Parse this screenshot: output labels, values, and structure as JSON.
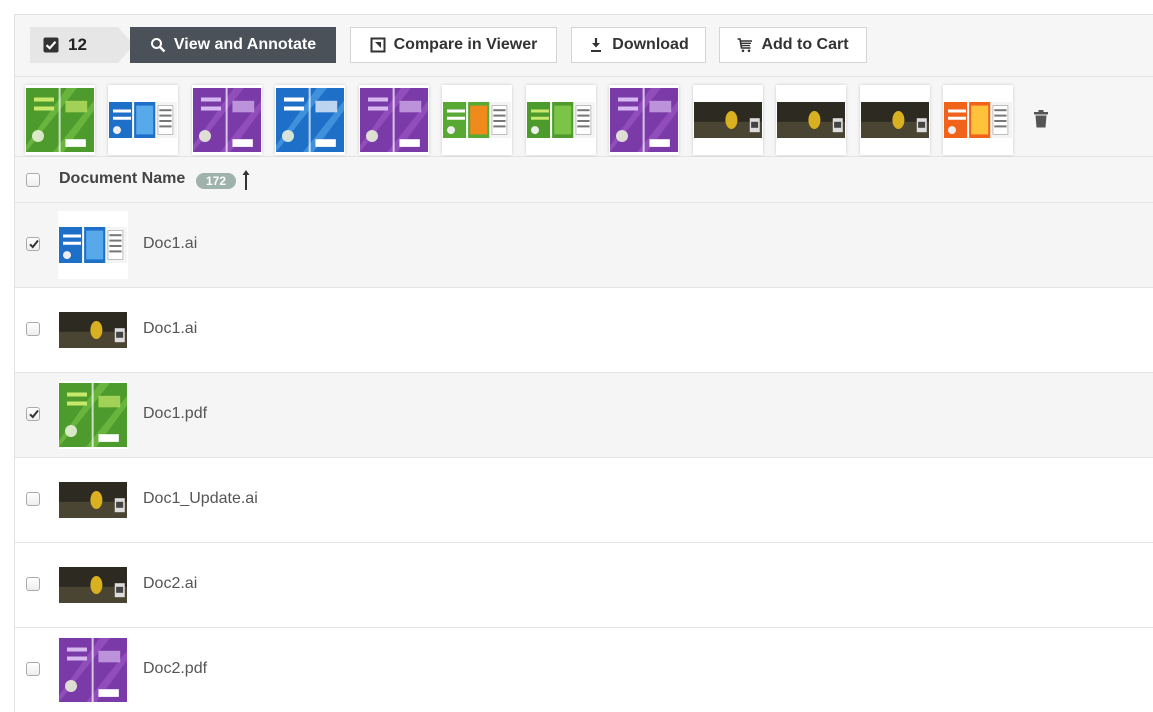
{
  "toolbar": {
    "selected_count": "12",
    "view_annotate_label": "View and Annotate",
    "compare_label": "Compare in Viewer",
    "download_label": "Download",
    "add_to_cart_label": "Add to Cart"
  },
  "thumbnails": [
    {
      "kind": "green-tall"
    },
    {
      "kind": "blue-wide"
    },
    {
      "kind": "purple-tall"
    },
    {
      "kind": "blue-tall"
    },
    {
      "kind": "purple-tall"
    },
    {
      "kind": "greenorange-wide"
    },
    {
      "kind": "green-wide"
    },
    {
      "kind": "purple-tall"
    },
    {
      "kind": "dark-wide"
    },
    {
      "kind": "dark-wide"
    },
    {
      "kind": "dark-wide"
    },
    {
      "kind": "orange-wide"
    }
  ],
  "header": {
    "column_title": "Document Name",
    "count": "172"
  },
  "rows": [
    {
      "name": "Doc1.ai",
      "checked": true,
      "kind": "blue-wide"
    },
    {
      "name": "Doc1.ai",
      "checked": false,
      "kind": "dark-wide"
    },
    {
      "name": "Doc1.pdf",
      "checked": true,
      "kind": "green-tall"
    },
    {
      "name": "Doc1_Update.ai",
      "checked": false,
      "kind": "dark-wide"
    },
    {
      "name": "Doc2.ai",
      "checked": false,
      "kind": "dark-wide"
    },
    {
      "name": "Doc2.pdf",
      "checked": false,
      "kind": "purple-tall"
    }
  ],
  "icons": {
    "selected_badge": "checkbox-checked-icon",
    "view": "search-icon",
    "compare": "compare-icon",
    "download": "download-icon",
    "cart": "cart-icon",
    "remove": "trash-icon",
    "sort": "sort-ascending-icon"
  },
  "colors": {
    "dark_button": "#4a5158",
    "count_pill": "#9fb3ac",
    "panel_bg": "#f6f6f6",
    "selected_row": "#f5f5f5"
  }
}
